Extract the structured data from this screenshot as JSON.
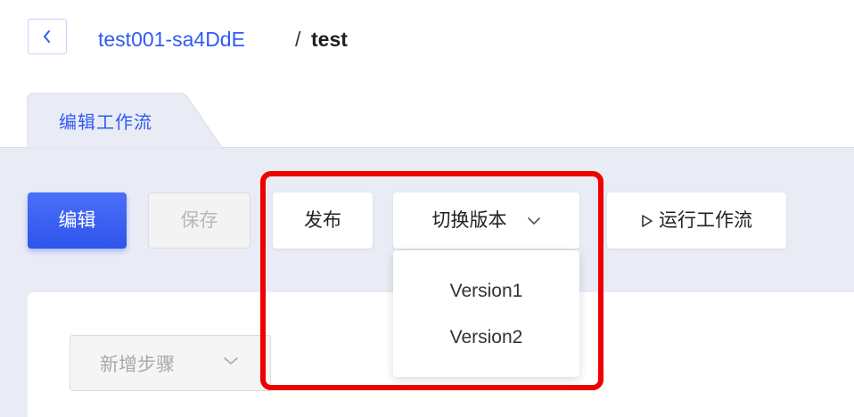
{
  "header": {
    "back_icon": "chevron-left-icon",
    "project_name": "test001-sa4DdE",
    "separator": "/",
    "workflow_name": "test"
  },
  "tabs": [
    {
      "label": "编辑工作流",
      "active": true
    }
  ],
  "toolbar": {
    "edit_label": "编辑",
    "save_label": "保存",
    "publish_label": "发布",
    "switch_version_label": "切换版本",
    "switch_version_icon": "chevron-down-icon",
    "run_icon": "play-outline-icon",
    "run_label": "运行工作流"
  },
  "version_dropdown": {
    "open": true,
    "options": [
      "Version1",
      "Version2"
    ]
  },
  "editor": {
    "add_step_label": "新增步骤",
    "add_step_icon": "chevron-down-icon",
    "add_step_disabled": true
  },
  "colors": {
    "primary": "#2f5cf0",
    "tab_band": "#e9ebf5",
    "highlight": "#ee0000",
    "disabled_text": "#b8b8b8"
  }
}
